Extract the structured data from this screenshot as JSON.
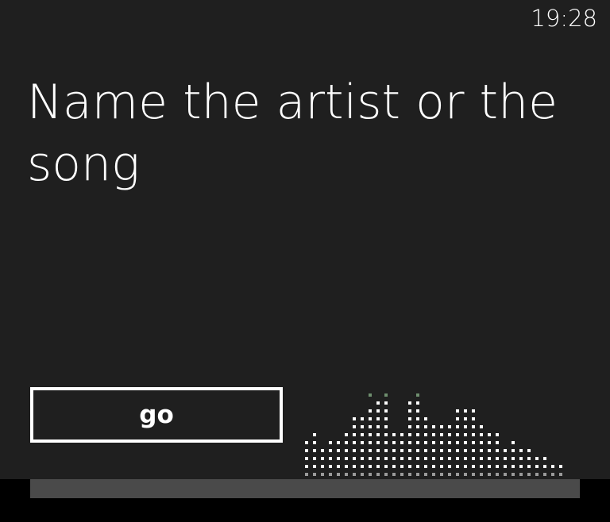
{
  "status_bar": {
    "clock": "19:28"
  },
  "quiz": {
    "prompt": "Name the artist or the song",
    "go_label": "go"
  },
  "equalizer": {
    "icon": "audio-visualizer",
    "dot_color": "#ffffff",
    "dim_color": "#9a9a9a",
    "peak_color": "#6f8f6f",
    "levels": [
      5,
      6,
      4,
      5,
      5,
      6,
      8,
      8,
      9,
      10,
      10,
      6,
      6,
      10,
      10,
      8,
      7,
      7,
      7,
      9,
      9,
      9,
      7,
      6,
      6,
      4,
      5,
      4,
      4,
      3,
      3,
      2,
      2
    ],
    "peaks": [
      null,
      null,
      null,
      null,
      null,
      null,
      null,
      null,
      11,
      null,
      11,
      null,
      null,
      null,
      11,
      null,
      null,
      null,
      null,
      null,
      null,
      null,
      null,
      null,
      null,
      null,
      null,
      null,
      null,
      null,
      null,
      null,
      null
    ]
  },
  "playback": {
    "progress": 0
  },
  "colors": {
    "background": "#1f1f1f",
    "bottom_band": "#000000",
    "track": "#4a4a4a",
    "text": "#ffffff"
  }
}
